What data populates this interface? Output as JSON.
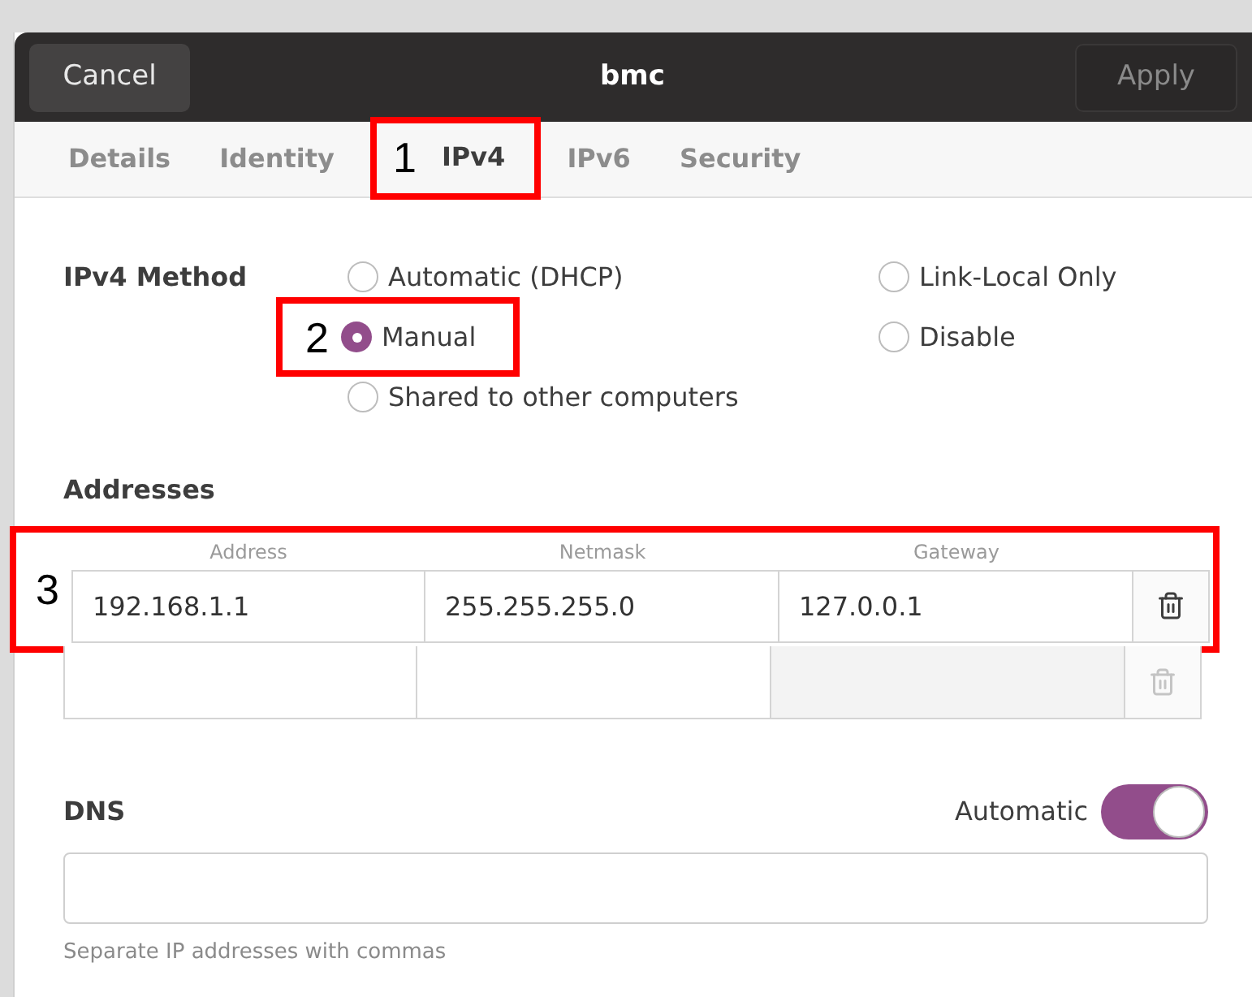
{
  "header": {
    "cancel": "Cancel",
    "title": "bmc",
    "apply": "Apply",
    "apply_disabled": true
  },
  "tabs": [
    {
      "label": "Details",
      "selected": false
    },
    {
      "label": "Identity",
      "selected": false
    },
    {
      "label": "IPv4",
      "selected": true,
      "callout": "1"
    },
    {
      "label": "IPv6",
      "selected": false
    },
    {
      "label": "Security",
      "selected": false
    }
  ],
  "method": {
    "label": "IPv4 Method",
    "columns": [
      [
        {
          "label": "Automatic (DHCP)",
          "selected": false
        },
        {
          "label": "Manual",
          "selected": true,
          "callout": "2"
        },
        {
          "label": "Shared to other computers",
          "selected": false
        }
      ],
      [
        {
          "label": "Link-Local Only",
          "selected": false
        },
        {
          "label": "Disable",
          "selected": false
        }
      ]
    ]
  },
  "addresses": {
    "title": "Addresses",
    "columns": [
      "Address",
      "Netmask",
      "Gateway"
    ],
    "rows": [
      {
        "values": [
          "192.168.1.1",
          "255.255.255.0",
          "127.0.0.1"
        ],
        "gateway_disabled": false,
        "delete_disabled": false,
        "callout": "3"
      },
      {
        "values": [],
        "gateway_disabled": true,
        "delete_disabled": true
      }
    ]
  },
  "dns": {
    "title": "DNS",
    "toggle_label": "Automatic",
    "automatic": true,
    "hint": "Separate IP addresses with commas"
  }
}
